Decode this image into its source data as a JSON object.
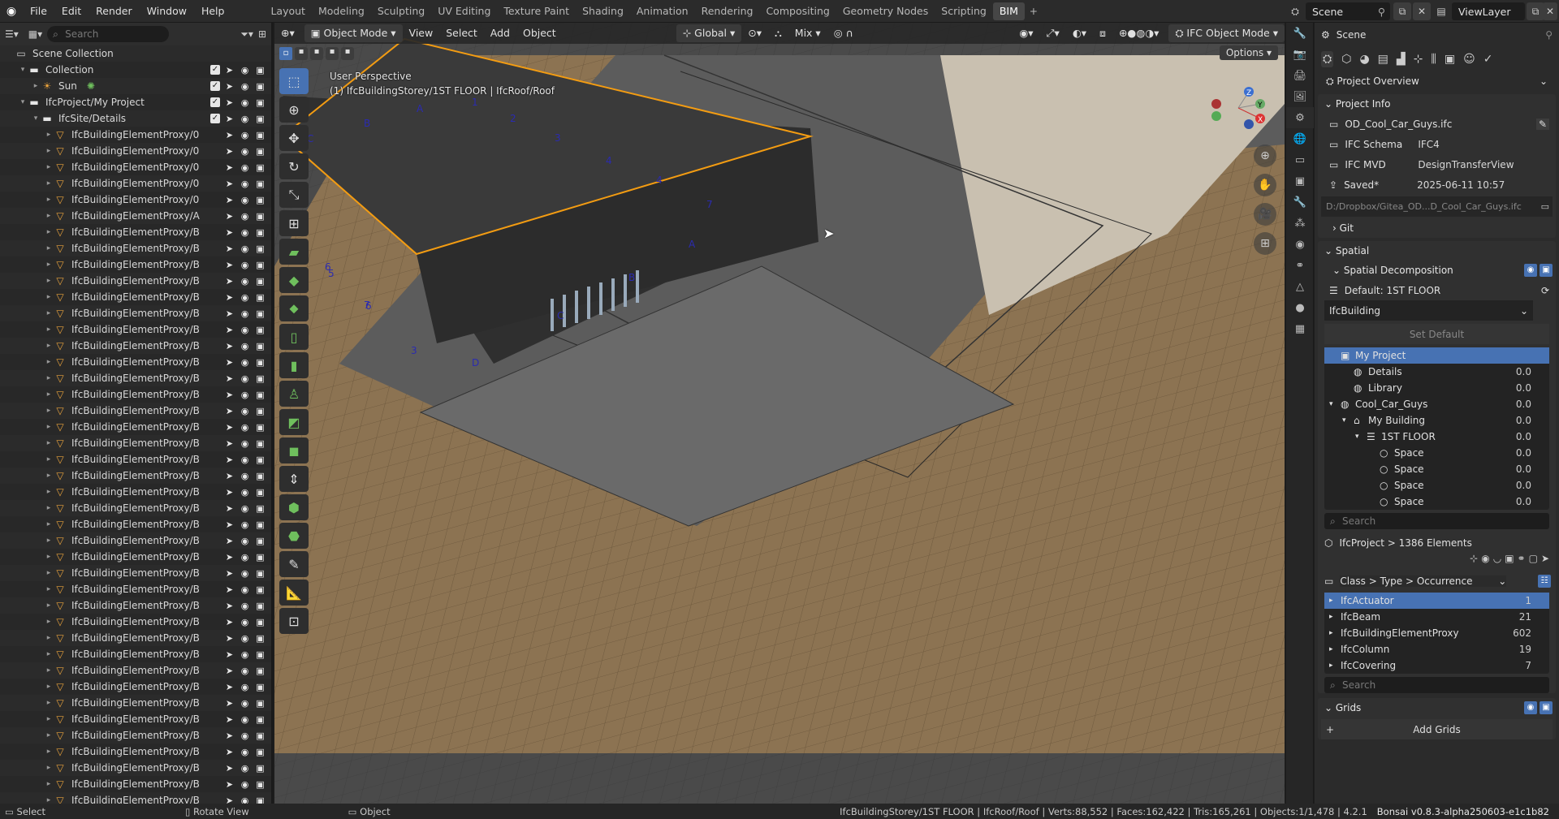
{
  "menu": [
    "File",
    "Edit",
    "Render",
    "Window",
    "Help"
  ],
  "workspaces": [
    "Layout",
    "Modeling",
    "Sculpting",
    "UV Editing",
    "Texture Paint",
    "Shading",
    "Animation",
    "Rendering",
    "Compositing",
    "Geometry Nodes",
    "Scripting",
    "BIM"
  ],
  "active_workspace": "BIM",
  "scene_name": "Scene",
  "view_layer": "ViewLayer",
  "outliner": {
    "search_placeholder": "Search",
    "rows": [
      {
        "indent": 0,
        "exp": "",
        "icon": "scene",
        "label": "Scene Collection",
        "checks": false
      },
      {
        "indent": 1,
        "exp": "▾",
        "icon": "collection",
        "label": "Collection",
        "checks": true
      },
      {
        "indent": 2,
        "exp": "▸",
        "icon": "light",
        "label": "Sun",
        "checks": true,
        "extra": "sun"
      },
      {
        "indent": 1,
        "exp": "▾",
        "icon": "collection",
        "label": "IfcProject/My Project",
        "checks": true
      },
      {
        "indent": 2,
        "exp": "▾",
        "icon": "collection",
        "label": "IfcSite/Details",
        "checks": true
      },
      {
        "indent": 3,
        "exp": "▸",
        "icon": "mesh",
        "label": "IfcBuildingElementProxy/0"
      },
      {
        "indent": 3,
        "exp": "▸",
        "icon": "mesh",
        "label": "IfcBuildingElementProxy/0"
      },
      {
        "indent": 3,
        "exp": "▸",
        "icon": "mesh",
        "label": "IfcBuildingElementProxy/0"
      },
      {
        "indent": 3,
        "exp": "▸",
        "icon": "mesh",
        "label": "IfcBuildingElementProxy/0"
      },
      {
        "indent": 3,
        "exp": "▸",
        "icon": "mesh",
        "label": "IfcBuildingElementProxy/0"
      },
      {
        "indent": 3,
        "exp": "▸",
        "icon": "mesh",
        "label": "IfcBuildingElementProxy/A"
      },
      {
        "indent": 3,
        "exp": "▸",
        "icon": "mesh",
        "label": "IfcBuildingElementProxy/B"
      },
      {
        "indent": 3,
        "exp": "▸",
        "icon": "mesh",
        "label": "IfcBuildingElementProxy/B"
      },
      {
        "indent": 3,
        "exp": "▸",
        "icon": "mesh",
        "label": "IfcBuildingElementProxy/B"
      },
      {
        "indent": 3,
        "exp": "▸",
        "icon": "mesh",
        "label": "IfcBuildingElementProxy/B"
      },
      {
        "indent": 3,
        "exp": "▸",
        "icon": "mesh",
        "label": "IfcBuildingElementProxy/B"
      },
      {
        "indent": 3,
        "exp": "▸",
        "icon": "mesh",
        "label": "IfcBuildingElementProxy/B"
      },
      {
        "indent": 3,
        "exp": "▸",
        "icon": "mesh",
        "label": "IfcBuildingElementProxy/B"
      },
      {
        "indent": 3,
        "exp": "▸",
        "icon": "mesh",
        "label": "IfcBuildingElementProxy/B"
      },
      {
        "indent": 3,
        "exp": "▸",
        "icon": "mesh",
        "label": "IfcBuildingElementProxy/B"
      },
      {
        "indent": 3,
        "exp": "▸",
        "icon": "mesh",
        "label": "IfcBuildingElementProxy/B"
      },
      {
        "indent": 3,
        "exp": "▸",
        "icon": "mesh",
        "label": "IfcBuildingElementProxy/B"
      },
      {
        "indent": 3,
        "exp": "▸",
        "icon": "mesh",
        "label": "IfcBuildingElementProxy/B"
      },
      {
        "indent": 3,
        "exp": "▸",
        "icon": "mesh",
        "label": "IfcBuildingElementProxy/B"
      },
      {
        "indent": 3,
        "exp": "▸",
        "icon": "mesh",
        "label": "IfcBuildingElementProxy/B"
      },
      {
        "indent": 3,
        "exp": "▸",
        "icon": "mesh",
        "label": "IfcBuildingElementProxy/B"
      },
      {
        "indent": 3,
        "exp": "▸",
        "icon": "mesh",
        "label": "IfcBuildingElementProxy/B"
      },
      {
        "indent": 3,
        "exp": "▸",
        "icon": "mesh",
        "label": "IfcBuildingElementProxy/B"
      },
      {
        "indent": 3,
        "exp": "▸",
        "icon": "mesh",
        "label": "IfcBuildingElementProxy/B"
      },
      {
        "indent": 3,
        "exp": "▸",
        "icon": "mesh",
        "label": "IfcBuildingElementProxy/B"
      },
      {
        "indent": 3,
        "exp": "▸",
        "icon": "mesh",
        "label": "IfcBuildingElementProxy/B"
      },
      {
        "indent": 3,
        "exp": "▸",
        "icon": "mesh",
        "label": "IfcBuildingElementProxy/B"
      },
      {
        "indent": 3,
        "exp": "▸",
        "icon": "mesh",
        "label": "IfcBuildingElementProxy/B"
      },
      {
        "indent": 3,
        "exp": "▸",
        "icon": "mesh",
        "label": "IfcBuildingElementProxy/B"
      },
      {
        "indent": 3,
        "exp": "▸",
        "icon": "mesh",
        "label": "IfcBuildingElementProxy/B"
      },
      {
        "indent": 3,
        "exp": "▸",
        "icon": "mesh",
        "label": "IfcBuildingElementProxy/B"
      },
      {
        "indent": 3,
        "exp": "▸",
        "icon": "mesh",
        "label": "IfcBuildingElementProxy/B"
      },
      {
        "indent": 3,
        "exp": "▸",
        "icon": "mesh",
        "label": "IfcBuildingElementProxy/B"
      },
      {
        "indent": 3,
        "exp": "▸",
        "icon": "mesh",
        "label": "IfcBuildingElementProxy/B"
      },
      {
        "indent": 3,
        "exp": "▸",
        "icon": "mesh",
        "label": "IfcBuildingElementProxy/B"
      },
      {
        "indent": 3,
        "exp": "▸",
        "icon": "mesh",
        "label": "IfcBuildingElementProxy/B"
      },
      {
        "indent": 3,
        "exp": "▸",
        "icon": "mesh",
        "label": "IfcBuildingElementProxy/B"
      },
      {
        "indent": 3,
        "exp": "▸",
        "icon": "mesh",
        "label": "IfcBuildingElementProxy/B"
      },
      {
        "indent": 3,
        "exp": "▸",
        "icon": "mesh",
        "label": "IfcBuildingElementProxy/B"
      },
      {
        "indent": 3,
        "exp": "▸",
        "icon": "mesh",
        "label": "IfcBuildingElementProxy/B"
      },
      {
        "indent": 3,
        "exp": "▸",
        "icon": "mesh",
        "label": "IfcBuildingElementProxy/B"
      },
      {
        "indent": 3,
        "exp": "▸",
        "icon": "mesh",
        "label": "IfcBuildingElementProxy/B"
      },
      {
        "indent": 3,
        "exp": "▸",
        "icon": "mesh",
        "label": "IfcBuildingElementProxy/B"
      },
      {
        "indent": 3,
        "exp": "▸",
        "icon": "mesh",
        "label": "IfcBuildingElementProxy/B"
      }
    ]
  },
  "viewport": {
    "mode": "Object Mode",
    "menus": [
      "View",
      "Select",
      "Add",
      "Object"
    ],
    "orientation": "Global",
    "snap": "Mix",
    "ifc_mode": "IFC Object Mode",
    "options": "Options",
    "perspective": "User Perspective",
    "context": "(1) IfcBuildingStorey/1ST FLOOR | IfcRoof/Roof",
    "grid_labels": [
      "A",
      "B",
      "C",
      "1",
      "2",
      "3",
      "4",
      "5",
      "6",
      "7",
      "A",
      "B",
      "C",
      "D",
      "3",
      "5",
      "6",
      "7",
      "4"
    ]
  },
  "properties": {
    "scene_label": "Scene",
    "overview": "Project Overview",
    "project_info_title": "Project Info",
    "file": "OD_Cool_Car_Guys.ifc",
    "schema_label": "IFC Schema",
    "schema_value": "IFC4",
    "mvd_label": "IFC MVD",
    "mvd_value": "DesignTransferView",
    "saved_label": "Saved*",
    "saved_value": "2025-06-11 10:57",
    "path": "D:/Dropbox/Gitea_OD...D_Cool_Car_Guys.ifc",
    "git": "Git",
    "spatial": "Spatial",
    "spatial_decomp": "Spatial Decomposition",
    "default_label": "Default: 1ST FLOOR",
    "building_type": "IfcBuilding",
    "set_default": "Set Default",
    "tree": [
      {
        "indent": 0,
        "exp": "",
        "icon": "▣",
        "label": "My Project",
        "num": "",
        "sel": true
      },
      {
        "indent": 1,
        "exp": "",
        "icon": "◍",
        "label": "Details",
        "num": "0.0"
      },
      {
        "indent": 1,
        "exp": "",
        "icon": "◍",
        "label": "Library",
        "num": "0.0"
      },
      {
        "indent": 0,
        "exp": "▾",
        "icon": "◍",
        "label": "Cool_Car_Guys",
        "num": "0.0"
      },
      {
        "indent": 1,
        "exp": "▾",
        "icon": "⌂",
        "label": "My Building",
        "num": "0.0"
      },
      {
        "indent": 2,
        "exp": "▾",
        "icon": "☰",
        "label": "1ST FLOOR",
        "num": "0.0"
      },
      {
        "indent": 3,
        "exp": "",
        "icon": "○",
        "label": "Space",
        "num": "0.0"
      },
      {
        "indent": 3,
        "exp": "",
        "icon": "○",
        "label": "Space",
        "num": "0.0"
      },
      {
        "indent": 3,
        "exp": "",
        "icon": "○",
        "label": "Space",
        "num": "0.0"
      },
      {
        "indent": 3,
        "exp": "",
        "icon": "○",
        "label": "Space",
        "num": "0.0"
      }
    ],
    "search_placeholder": "Search",
    "elements_summary": "IfcProject > 1386 Elements",
    "class_mode": "Class > Type > Occurrence",
    "classes": [
      {
        "label": "IfcActuator",
        "num": "1",
        "sel": true
      },
      {
        "label": "IfcBeam",
        "num": "21"
      },
      {
        "label": "IfcBuildingElementProxy",
        "num": "602"
      },
      {
        "label": "IfcColumn",
        "num": "19"
      },
      {
        "label": "IfcCovering",
        "num": "7"
      }
    ],
    "grids": "Grids",
    "add_grids": "Add Grids"
  },
  "status": {
    "select": "Select",
    "rotate": "Rotate View",
    "object": "Object",
    "info": "IfcBuildingStorey/1ST FLOOR | IfcRoof/Roof | Verts:88,552 | Faces:162,422 | Tris:165,261 | Objects:1/1,478 | 4.2.1",
    "version": "Bonsai v0.8.3-alpha250603-e1c1b82"
  }
}
